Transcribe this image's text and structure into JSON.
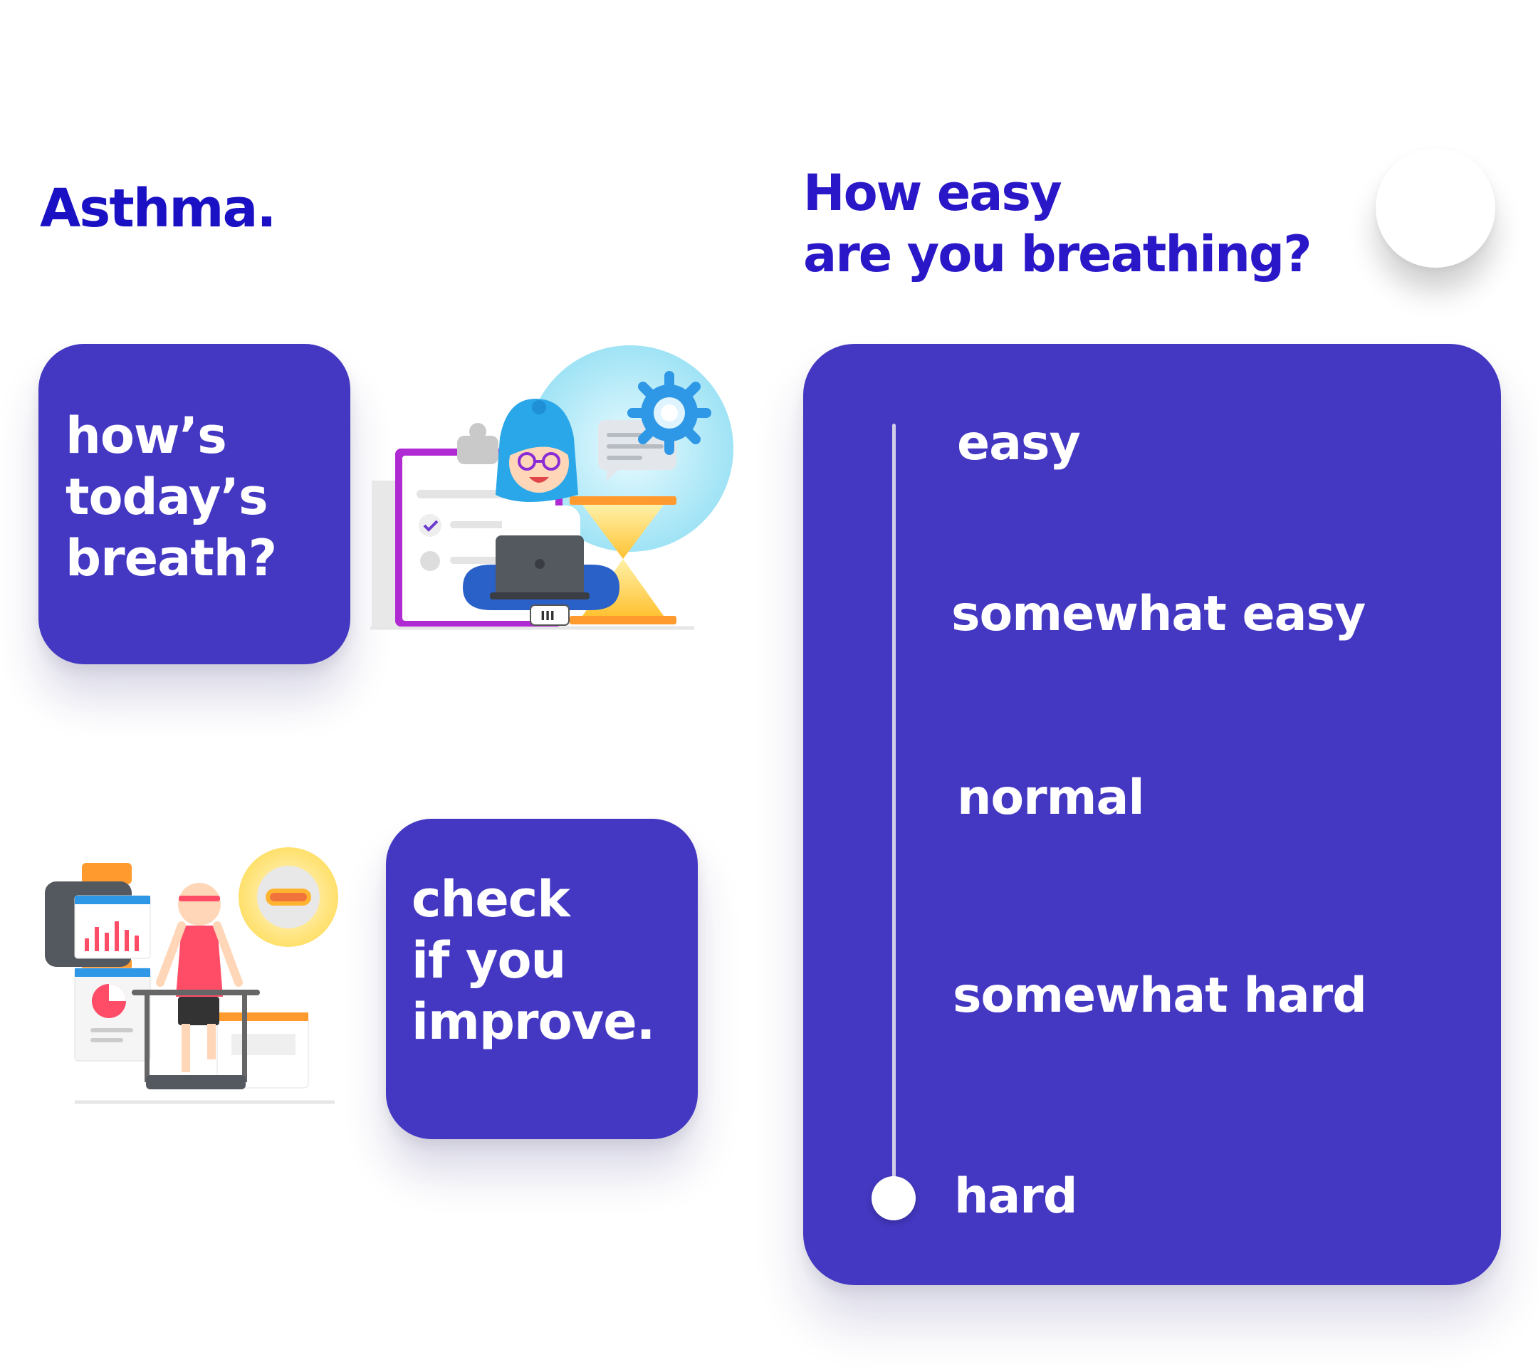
{
  "app": {
    "brand": "Asthma.",
    "question_line1": "How easy",
    "question_line2": "are you breathing?"
  },
  "cards": {
    "daily": {
      "line1": "how’s",
      "line2": "today’s",
      "line3": "breath?"
    },
    "improve": {
      "line1": "check",
      "line2": "if you",
      "line3": "improve."
    }
  },
  "scale": {
    "options": [
      "easy",
      "somewhat easy",
      "normal",
      "somewhat hard",
      "hard"
    ],
    "selected": "hard"
  },
  "colors": {
    "accent": "#4438c2",
    "brand_text": "#1a10c4",
    "white": "#ffffff"
  },
  "illustration_daily": {
    "chip": "III"
  },
  "icons": [
    "clipboard-icon",
    "gear-icon",
    "chat-icon",
    "hourglass-icon",
    "laptop-icon",
    "smartwatch-icon",
    "bar-chart-icon",
    "pie-chart-icon",
    "hotdog-icon",
    "treadmill-icon"
  ]
}
